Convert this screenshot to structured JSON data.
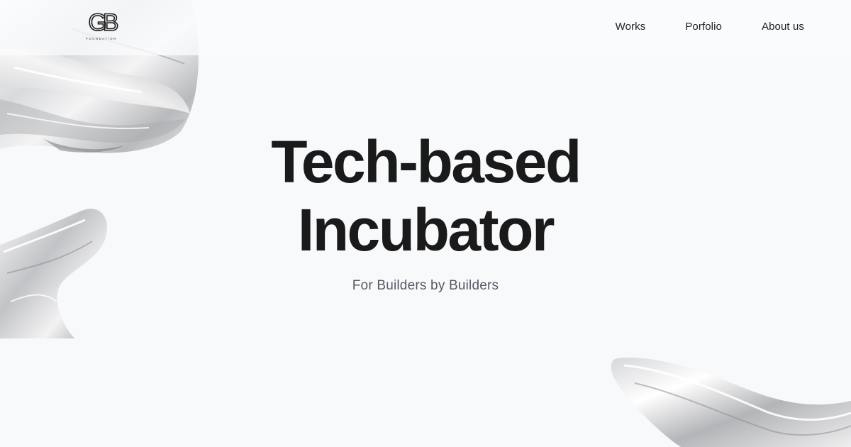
{
  "brand": {
    "logo_letters": "GB",
    "logo_subtext": "FOUNDATION"
  },
  "nav": {
    "items": [
      {
        "label": "Works"
      },
      {
        "label": "Porfolio"
      },
      {
        "label": "About us"
      }
    ]
  },
  "hero": {
    "title_line1": "Tech-based",
    "title_line2": "Incubator",
    "subtitle": "For Builders by Builders"
  },
  "colors": {
    "background": "#f8f9fb",
    "text": "#1a1a1a",
    "subtitle": "#555b63"
  }
}
